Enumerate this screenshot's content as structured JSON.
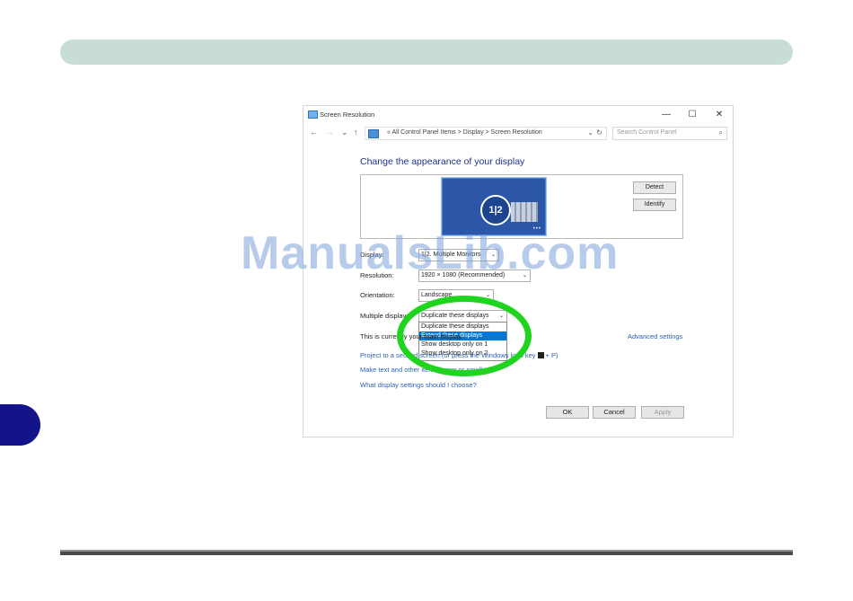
{
  "page": {
    "watermark": "ManualsLib.com"
  },
  "window": {
    "title": "Screen Resolution",
    "controls": {
      "minimize": "—",
      "maximize": "☐",
      "close": "✕"
    },
    "address": {
      "back": "←",
      "forward": "→",
      "recent": "⌄",
      "up": "↑",
      "path": "« All Control Panel Items  >  Display  >  Screen Resolution",
      "dropdown": "⌄",
      "refresh": "↻",
      "search_placeholder": "Search Control Panel",
      "search_icon": "⌕"
    },
    "heading": "Change the appearance of your display",
    "monitor_panel": {
      "monitor_label": "1|2",
      "dots": "•••",
      "detect_label": "Detect",
      "identify_label": "Identify"
    },
    "display": {
      "label": "Display:",
      "value": "1|2. Multiple Monitors"
    },
    "resolution": {
      "label": "Resolution:",
      "value": "1920 × 1080 (Recommended)"
    },
    "orientation": {
      "label": "Orientation:",
      "value": "Landscape"
    },
    "multiple_displays": {
      "label": "Multiple displays:",
      "value": "Duplicate these displays",
      "options": [
        "Duplicate these displays",
        "Extend these displays",
        "Show desktop only on 1",
        "Show desktop only on 2"
      ],
      "highlighted_index": 1
    },
    "status_text": "This is currently your main display.",
    "advanced_link": "Advanced settings",
    "links": {
      "project_prefix": "Project to a second screen (or press the Windows logo key",
      "project_suffix": "+ P)",
      "make_text": "Make text and other items larger or smaller",
      "help": "What display settings should I choose?"
    },
    "buttons": {
      "ok": "OK",
      "cancel": "Cancel",
      "apply": "Apply"
    }
  },
  "colors": {
    "highlight": "#1ed41e",
    "link": "#2b5fb8",
    "heading": "#1e3287",
    "selection": "#0078d7",
    "top_bar": "#c8ddd8",
    "side_tab": "#13148a"
  }
}
